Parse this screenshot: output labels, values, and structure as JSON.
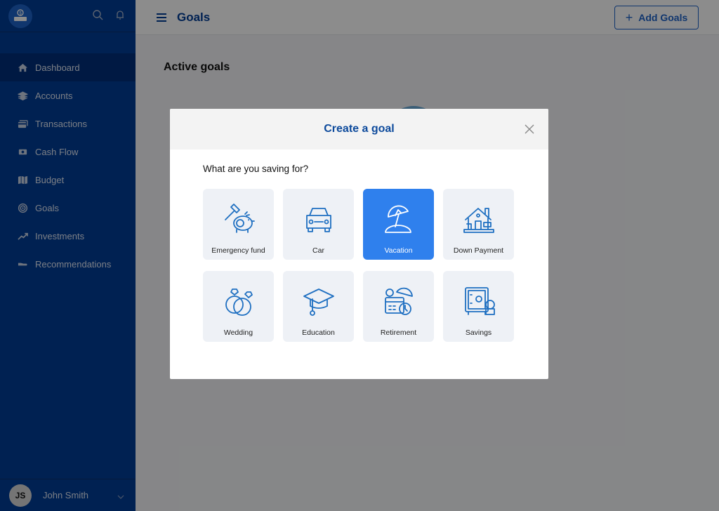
{
  "sidebar": {
    "items": [
      {
        "label": "Dashboard",
        "icon": "home-icon",
        "active": true
      },
      {
        "label": "Accounts",
        "icon": "layers-icon"
      },
      {
        "label": "Transactions",
        "icon": "credit-card-icon"
      },
      {
        "label": "Cash Flow",
        "icon": "cash-icon"
      },
      {
        "label": "Budget",
        "icon": "map-icon"
      },
      {
        "label": "Goals",
        "icon": "target-icon"
      },
      {
        "label": "Investments",
        "icon": "trend-up-icon"
      },
      {
        "label": "Recommendations",
        "icon": "hand-icon"
      }
    ],
    "user": {
      "initials": "JS",
      "name": "John Smith"
    }
  },
  "header": {
    "title": "Goals",
    "add_button": "Add Goals",
    "add_icon": "+"
  },
  "main": {
    "section_title": "Active goals"
  },
  "modal": {
    "title": "Create a goal",
    "question": "What are you saving for?",
    "goals": [
      {
        "label": "Emergency fund",
        "icon": "piggy-bank-hammer-icon"
      },
      {
        "label": "Car",
        "icon": "car-icon"
      },
      {
        "label": "Vacation",
        "icon": "beach-umbrella-icon",
        "selected": true
      },
      {
        "label": "Down Payment",
        "icon": "house-icon"
      },
      {
        "label": "Wedding",
        "icon": "rings-icon"
      },
      {
        "label": "Education",
        "icon": "graduation-cap-icon"
      },
      {
        "label": "Retirement",
        "icon": "calendar-clock-icon"
      },
      {
        "label": "Savings",
        "icon": "safe-icon"
      }
    ]
  },
  "colors": {
    "sidebar_bg": "#003c96",
    "accent": "#2f80ed",
    "title_blue": "#0d4a9c"
  }
}
